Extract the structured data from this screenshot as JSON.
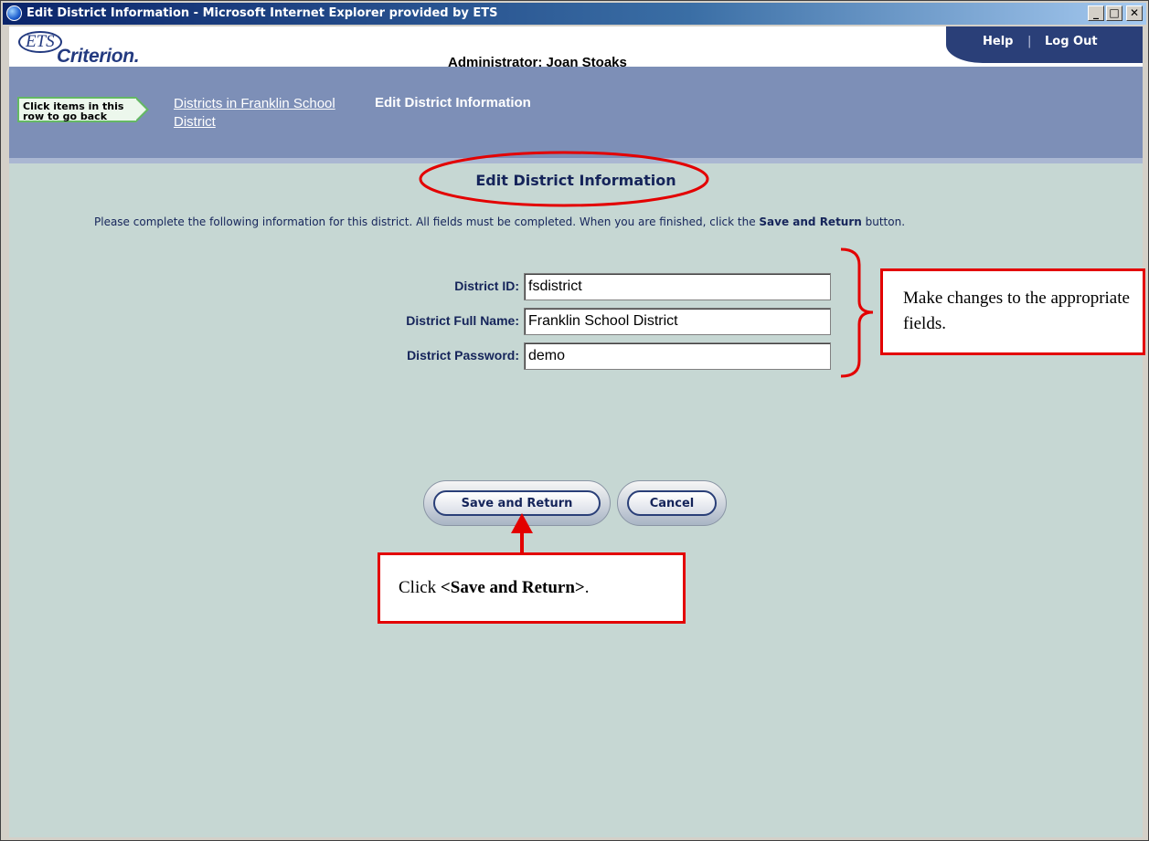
{
  "window": {
    "title": "Edit District Information - Microsoft Internet Explorer provided by ETS",
    "min_glyph": "_",
    "max_glyph": "□",
    "close_glyph": "✕"
  },
  "header": {
    "logo_ets": "ETS",
    "logo_name": "Criterion.",
    "administrator": "Administrator: Joan Stoaks",
    "help": "Help",
    "separator": "|",
    "logout": "Log Out"
  },
  "breadcrumb": {
    "hint": "Click items in this row to go back",
    "link": "Districts in Franklin School District",
    "current": "Edit District Information"
  },
  "page": {
    "title": "Edit District Information",
    "instructions_pre": "Please complete the following information for this district. All fields must be completed. When you are finished, click the ",
    "instructions_bold": "Save and Return",
    "instructions_post": " button."
  },
  "form": {
    "district_id_label": "District ID:",
    "district_id_value": "fsdistrict",
    "full_name_label": "District Full Name:",
    "full_name_value": "Franklin School District",
    "password_label": "District Password:",
    "password_value": "demo"
  },
  "buttons": {
    "save": "Save and Return",
    "cancel": "Cancel"
  },
  "annotations": {
    "fields_note": "Make changes to the appropriate fields.",
    "click_pre": "Click ",
    "click_bold": "<Save and Return>",
    "click_post": "."
  },
  "colors": {
    "annotation_red": "#e30000",
    "navy": "#15245a",
    "crumb_bar": "#7d8fb7",
    "page_bg": "#c6d7d3"
  }
}
